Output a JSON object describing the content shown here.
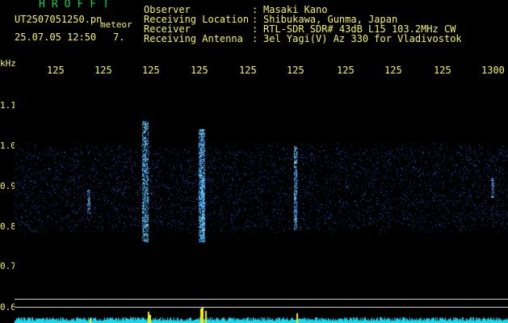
{
  "header": {
    "app_title": "HROFFT",
    "filename": "UT2507051250.pn",
    "detection_label": "meteor",
    "datetime": "25.07.05 12:50",
    "count": "7."
  },
  "info": [
    {
      "label": "Observer",
      "value": "Masaki Kano"
    },
    {
      "label": "Receiving Location",
      "value": "Shibukawa, Gunma, Japan"
    },
    {
      "label": "Receiver",
      "value": "RTL-SDR SDR# 43dB L15 103.2MHz CW"
    },
    {
      "label": "Receiving Antenna",
      "value": "3el Yagi(V) Az 330 for Vladivostok"
    }
  ],
  "axes": {
    "y_unit": "kHz",
    "x_tick_labels": [
      "125",
      "125",
      "125",
      "125",
      "125",
      "125",
      "125",
      "125",
      "125",
      "1300"
    ],
    "y_tick_labels": [
      "1.1",
      "1.0",
      "0.9",
      "0.8",
      "0.7",
      "0.6"
    ]
  },
  "colors": {
    "background": "#000000",
    "text": "#f4f46a",
    "title": "#19d14b",
    "noise": "#2b50c8",
    "signal": "#4ad0e0",
    "level": "#18d8f0",
    "peak": "#f0f020"
  }
}
